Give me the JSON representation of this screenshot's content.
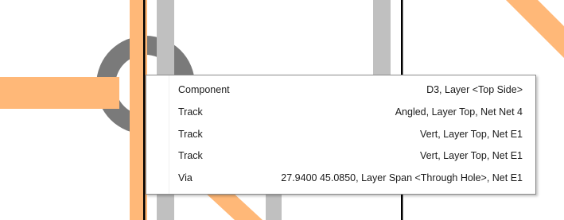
{
  "popup": {
    "items": [
      {
        "type": "Component",
        "details": "D3, Layer <Top Side>"
      },
      {
        "type": "Track",
        "details": "Angled, Layer Top, Net Net 4"
      },
      {
        "type": "Track",
        "details": "Vert, Layer Top, Net E1"
      },
      {
        "type": "Track",
        "details": "Vert, Layer Top, Net E1"
      },
      {
        "type": "Via",
        "details": "27.9400 45.0850, Layer Span <Through Hole>, Net E1"
      }
    ]
  },
  "colors": {
    "copper_top": "#ffb878",
    "pad": "#7a7a7a",
    "track_gray": "#c0c0c0",
    "outline": "#000000"
  }
}
